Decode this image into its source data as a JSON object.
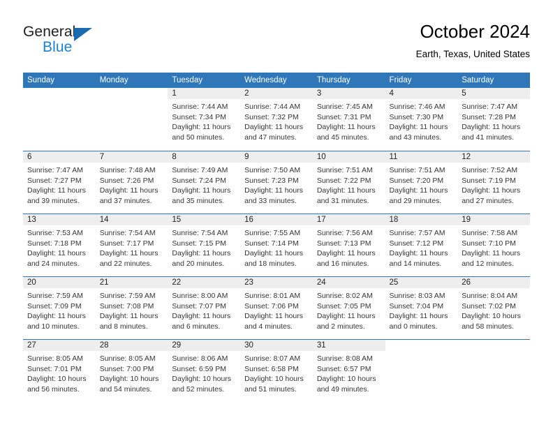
{
  "brand": {
    "name_part1": "General",
    "name_part2": "Blue",
    "accent_color": "#1c7fd0",
    "triangle_color": "#1b69b0",
    "logo_icon": "triangle-flag-icon"
  },
  "header": {
    "title": "October 2024",
    "subtitle": "Earth, Texas, United States",
    "header_bar_color": "#2f77b8",
    "daynum_strip_color": "#eeeeee"
  },
  "weekday_headers": [
    "Sunday",
    "Monday",
    "Tuesday",
    "Wednesday",
    "Thursday",
    "Friday",
    "Saturday"
  ],
  "weeks": [
    [
      {
        "day": "",
        "sunrise": "",
        "sunset": "",
        "daylight1": "",
        "daylight2": "",
        "blank": true
      },
      {
        "day": "",
        "sunrise": "",
        "sunset": "",
        "daylight1": "",
        "daylight2": "",
        "blank": true
      },
      {
        "day": "1",
        "sunrise": "Sunrise: 7:44 AM",
        "sunset": "Sunset: 7:34 PM",
        "daylight1": "Daylight: 11 hours",
        "daylight2": "and 50 minutes."
      },
      {
        "day": "2",
        "sunrise": "Sunrise: 7:44 AM",
        "sunset": "Sunset: 7:32 PM",
        "daylight1": "Daylight: 11 hours",
        "daylight2": "and 47 minutes."
      },
      {
        "day": "3",
        "sunrise": "Sunrise: 7:45 AM",
        "sunset": "Sunset: 7:31 PM",
        "daylight1": "Daylight: 11 hours",
        "daylight2": "and 45 minutes."
      },
      {
        "day": "4",
        "sunrise": "Sunrise: 7:46 AM",
        "sunset": "Sunset: 7:30 PM",
        "daylight1": "Daylight: 11 hours",
        "daylight2": "and 43 minutes."
      },
      {
        "day": "5",
        "sunrise": "Sunrise: 7:47 AM",
        "sunset": "Sunset: 7:28 PM",
        "daylight1": "Daylight: 11 hours",
        "daylight2": "and 41 minutes."
      }
    ],
    [
      {
        "day": "6",
        "sunrise": "Sunrise: 7:47 AM",
        "sunset": "Sunset: 7:27 PM",
        "daylight1": "Daylight: 11 hours",
        "daylight2": "and 39 minutes."
      },
      {
        "day": "7",
        "sunrise": "Sunrise: 7:48 AM",
        "sunset": "Sunset: 7:26 PM",
        "daylight1": "Daylight: 11 hours",
        "daylight2": "and 37 minutes."
      },
      {
        "day": "8",
        "sunrise": "Sunrise: 7:49 AM",
        "sunset": "Sunset: 7:24 PM",
        "daylight1": "Daylight: 11 hours",
        "daylight2": "and 35 minutes."
      },
      {
        "day": "9",
        "sunrise": "Sunrise: 7:50 AM",
        "sunset": "Sunset: 7:23 PM",
        "daylight1": "Daylight: 11 hours",
        "daylight2": "and 33 minutes."
      },
      {
        "day": "10",
        "sunrise": "Sunrise: 7:51 AM",
        "sunset": "Sunset: 7:22 PM",
        "daylight1": "Daylight: 11 hours",
        "daylight2": "and 31 minutes."
      },
      {
        "day": "11",
        "sunrise": "Sunrise: 7:51 AM",
        "sunset": "Sunset: 7:20 PM",
        "daylight1": "Daylight: 11 hours",
        "daylight2": "and 29 minutes."
      },
      {
        "day": "12",
        "sunrise": "Sunrise: 7:52 AM",
        "sunset": "Sunset: 7:19 PM",
        "daylight1": "Daylight: 11 hours",
        "daylight2": "and 27 minutes."
      }
    ],
    [
      {
        "day": "13",
        "sunrise": "Sunrise: 7:53 AM",
        "sunset": "Sunset: 7:18 PM",
        "daylight1": "Daylight: 11 hours",
        "daylight2": "and 24 minutes."
      },
      {
        "day": "14",
        "sunrise": "Sunrise: 7:54 AM",
        "sunset": "Sunset: 7:17 PM",
        "daylight1": "Daylight: 11 hours",
        "daylight2": "and 22 minutes."
      },
      {
        "day": "15",
        "sunrise": "Sunrise: 7:54 AM",
        "sunset": "Sunset: 7:15 PM",
        "daylight1": "Daylight: 11 hours",
        "daylight2": "and 20 minutes."
      },
      {
        "day": "16",
        "sunrise": "Sunrise: 7:55 AM",
        "sunset": "Sunset: 7:14 PM",
        "daylight1": "Daylight: 11 hours",
        "daylight2": "and 18 minutes."
      },
      {
        "day": "17",
        "sunrise": "Sunrise: 7:56 AM",
        "sunset": "Sunset: 7:13 PM",
        "daylight1": "Daylight: 11 hours",
        "daylight2": "and 16 minutes."
      },
      {
        "day": "18",
        "sunrise": "Sunrise: 7:57 AM",
        "sunset": "Sunset: 7:12 PM",
        "daylight1": "Daylight: 11 hours",
        "daylight2": "and 14 minutes."
      },
      {
        "day": "19",
        "sunrise": "Sunrise: 7:58 AM",
        "sunset": "Sunset: 7:10 PM",
        "daylight1": "Daylight: 11 hours",
        "daylight2": "and 12 minutes."
      }
    ],
    [
      {
        "day": "20",
        "sunrise": "Sunrise: 7:59 AM",
        "sunset": "Sunset: 7:09 PM",
        "daylight1": "Daylight: 11 hours",
        "daylight2": "and 10 minutes."
      },
      {
        "day": "21",
        "sunrise": "Sunrise: 7:59 AM",
        "sunset": "Sunset: 7:08 PM",
        "daylight1": "Daylight: 11 hours",
        "daylight2": "and 8 minutes."
      },
      {
        "day": "22",
        "sunrise": "Sunrise: 8:00 AM",
        "sunset": "Sunset: 7:07 PM",
        "daylight1": "Daylight: 11 hours",
        "daylight2": "and 6 minutes."
      },
      {
        "day": "23",
        "sunrise": "Sunrise: 8:01 AM",
        "sunset": "Sunset: 7:06 PM",
        "daylight1": "Daylight: 11 hours",
        "daylight2": "and 4 minutes."
      },
      {
        "day": "24",
        "sunrise": "Sunrise: 8:02 AM",
        "sunset": "Sunset: 7:05 PM",
        "daylight1": "Daylight: 11 hours",
        "daylight2": "and 2 minutes."
      },
      {
        "day": "25",
        "sunrise": "Sunrise: 8:03 AM",
        "sunset": "Sunset: 7:04 PM",
        "daylight1": "Daylight: 11 hours",
        "daylight2": "and 0 minutes."
      },
      {
        "day": "26",
        "sunrise": "Sunrise: 8:04 AM",
        "sunset": "Sunset: 7:02 PM",
        "daylight1": "Daylight: 10 hours",
        "daylight2": "and 58 minutes."
      }
    ],
    [
      {
        "day": "27",
        "sunrise": "Sunrise: 8:05 AM",
        "sunset": "Sunset: 7:01 PM",
        "daylight1": "Daylight: 10 hours",
        "daylight2": "and 56 minutes."
      },
      {
        "day": "28",
        "sunrise": "Sunrise: 8:05 AM",
        "sunset": "Sunset: 7:00 PM",
        "daylight1": "Daylight: 10 hours",
        "daylight2": "and 54 minutes."
      },
      {
        "day": "29",
        "sunrise": "Sunrise: 8:06 AM",
        "sunset": "Sunset: 6:59 PM",
        "daylight1": "Daylight: 10 hours",
        "daylight2": "and 52 minutes."
      },
      {
        "day": "30",
        "sunrise": "Sunrise: 8:07 AM",
        "sunset": "Sunset: 6:58 PM",
        "daylight1": "Daylight: 10 hours",
        "daylight2": "and 51 minutes."
      },
      {
        "day": "31",
        "sunrise": "Sunrise: 8:08 AM",
        "sunset": "Sunset: 6:57 PM",
        "daylight1": "Daylight: 10 hours",
        "daylight2": "and 49 minutes."
      },
      {
        "day": "",
        "sunrise": "",
        "sunset": "",
        "daylight1": "",
        "daylight2": "",
        "blank": true
      },
      {
        "day": "",
        "sunrise": "",
        "sunset": "",
        "daylight1": "",
        "daylight2": "",
        "blank": true
      }
    ]
  ]
}
